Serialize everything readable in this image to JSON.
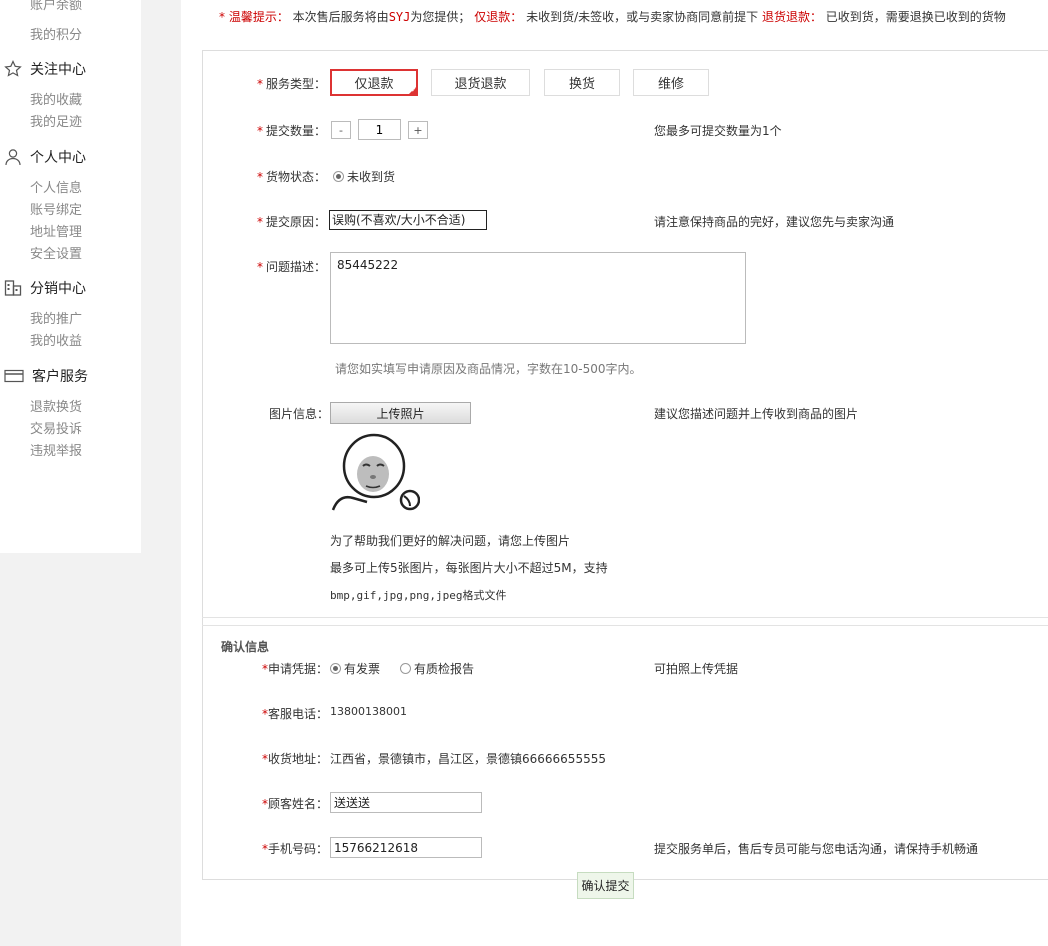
{
  "sidebar": {
    "cut_item": "账户余额",
    "points": "我的积分",
    "groups": [
      {
        "title": "关注中心",
        "icon": "star-icon",
        "items": [
          "我的收藏",
          "我的足迹"
        ]
      },
      {
        "title": "个人中心",
        "icon": "person-icon",
        "items": [
          "个人信息",
          "账号绑定",
          "地址管理",
          "安全设置"
        ]
      },
      {
        "title": "分销中心",
        "icon": "building-icon",
        "items": [
          "我的推广",
          "我的收益"
        ]
      },
      {
        "title": "客户服务",
        "icon": "card-icon",
        "items": [
          "退款换货",
          "交易投诉",
          "违规举报"
        ]
      }
    ]
  },
  "tip": {
    "star": "*",
    "label": "温馨提示：",
    "text1": "本次售后服务将由",
    "provider": "SYJ",
    "text2": "为您提供；",
    "refund_only_label": "仅退款：",
    "refund_only_desc": "未收到货/未签收，或与卖家协商同意前提下",
    "return_refund_label": "退货退款：",
    "return_refund_desc": "已收到货，需要退换已收到的货物"
  },
  "form": {
    "service_type_label": "服务类型：",
    "service_types": [
      "仅退款",
      "退货退款",
      "换货",
      "维修"
    ],
    "quantity_label": "提交数量：",
    "quantity_minus": "-",
    "quantity_value": "1",
    "quantity_plus": "+",
    "quantity_hint": "您最多可提交数量为1个",
    "goods_status_label": "货物状态：",
    "goods_status_value": "未收到货",
    "reason_label": "提交原因：",
    "reason_value": "误购(不喜欢/大小不合适)",
    "reason_hint": "请注意保持商品的完好，建议您先与卖家沟通",
    "desc_label": "问题描述：",
    "desc_value": "85445222",
    "desc_hint": "请您如实填写申请原因及商品情况，字数在10-500字内。",
    "image_label": "图片信息：",
    "upload_button": "上传照片",
    "image_hint": "建议您描述问题并上传收到商品的图片",
    "upload_note1": "为了帮助我们更好的解决问题，请您上传图片",
    "upload_note2": "最多可上传5张图片，每张图片大小不超过5M，支持",
    "upload_note3": "bmp,gif,jpg,png,jpeg格式文件"
  },
  "confirm": {
    "section_title": "确认信息",
    "voucher_label": "申请凭据：",
    "voucher_options": [
      "有发票",
      "有质检报告"
    ],
    "voucher_hint": "可拍照上传凭据",
    "phone_label": "客服电话：",
    "phone_value": "13800138001",
    "address_label": "收货地址：",
    "address_value": "江西省，景德镇市，昌江区，景德镇66666655555",
    "name_label": "顾客姓名：",
    "name_value": "送送送",
    "mobile_label": "手机号码：",
    "mobile_value": "15766212618",
    "mobile_hint": "提交服务单后，售后专员可能与您电话沟通，请保持手机畅通",
    "submit_button": "确认提交"
  },
  "colors": {
    "required": "#cc0000",
    "active_border": "#dd3333",
    "submit_bg": "#eef6ea"
  }
}
